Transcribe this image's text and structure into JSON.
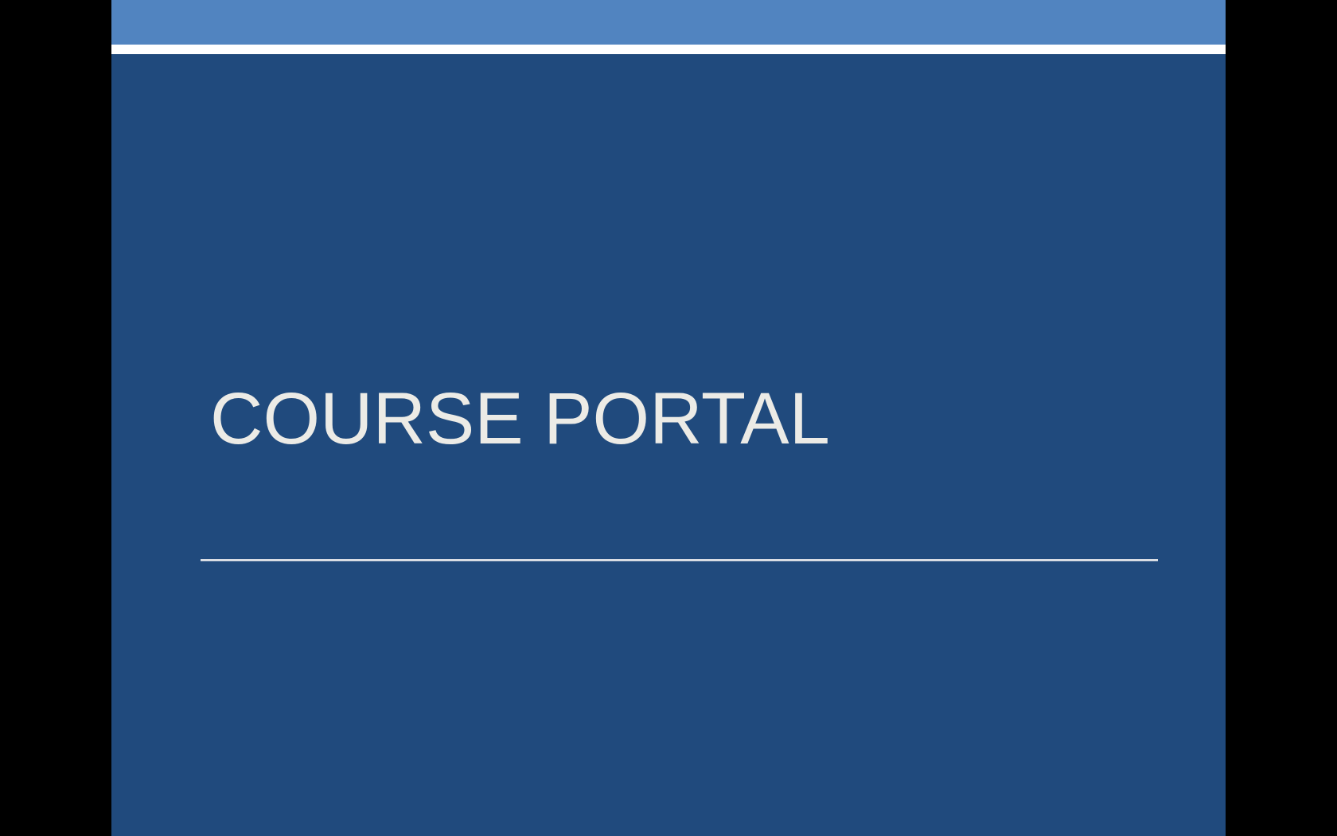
{
  "slide": {
    "title": "COURSE PORTAL"
  },
  "colors": {
    "background": "#000000",
    "slide_background": "#204a7d",
    "accent_band": "#5184c0",
    "stripe": "#ffffff",
    "title_text": "#ecebe6",
    "rule": "#d9dde4"
  }
}
